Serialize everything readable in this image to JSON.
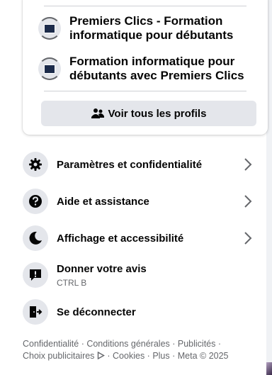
{
  "profiles": [
    {
      "name_line1": "Premiers Clics - Formation",
      "name_line2": "informatique pour débutants"
    },
    {
      "name_line1": "Formation informatique pour",
      "name_line2": "débutants avec Premiers Clics"
    }
  ],
  "see_all_label": "Voir tous les profils",
  "menu": {
    "settings": {
      "label": "Paramètres et confidentialité",
      "icon": "gear-icon"
    },
    "help": {
      "label": "Aide et assistance",
      "icon": "question-icon"
    },
    "display": {
      "label": "Affichage et accessibilité",
      "icon": "moon-icon"
    },
    "feedback": {
      "label": "Donner votre avis",
      "shortcut": "CTRL B",
      "icon": "feedback-icon"
    },
    "logout": {
      "label": "Se déconnecter",
      "icon": "logout-icon"
    }
  },
  "footer": {
    "privacy": "Confidentialité",
    "terms": "Conditions générales",
    "ads": "Publicités",
    "ad_choices": "Choix publicitaires",
    "cookies": "Cookies",
    "more": "Plus",
    "meta": "Meta © 2025",
    "sep": " · "
  },
  "colors": {
    "button_bg": "#e4e6eb",
    "text": "#050505",
    "secondary": "#65676b"
  }
}
